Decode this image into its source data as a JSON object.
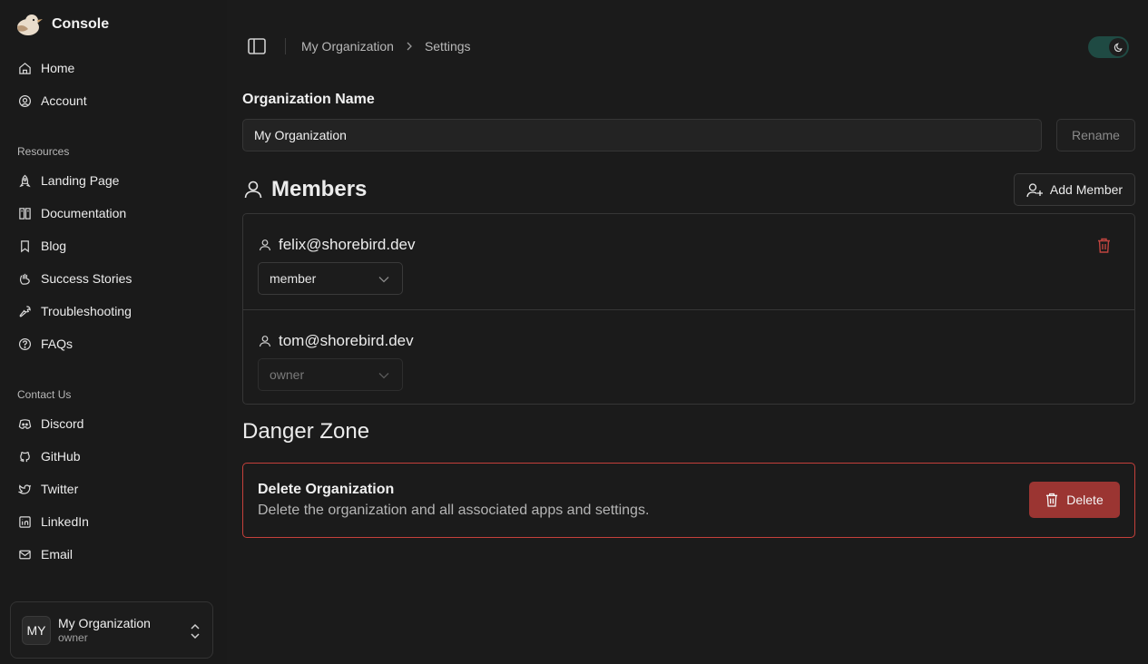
{
  "sidebar": {
    "brand": "Console",
    "primary": [
      {
        "label": "Home",
        "icon": "home-icon"
      },
      {
        "label": "Account",
        "icon": "account-icon"
      }
    ],
    "resources_label": "Resources",
    "resources": [
      {
        "label": "Landing Page",
        "icon": "rocket-icon"
      },
      {
        "label": "Documentation",
        "icon": "docs-icon"
      },
      {
        "label": "Blog",
        "icon": "bookmark-icon"
      },
      {
        "label": "Success Stories",
        "icon": "hand-clap-icon"
      },
      {
        "label": "Troubleshooting",
        "icon": "wrench-icon"
      },
      {
        "label": "FAQs",
        "icon": "help-circle-icon"
      }
    ],
    "contact_label": "Contact Us",
    "contact": [
      {
        "label": "Discord",
        "icon": "discord-icon"
      },
      {
        "label": "GitHub",
        "icon": "github-icon"
      },
      {
        "label": "Twitter",
        "icon": "twitter-icon"
      },
      {
        "label": "LinkedIn",
        "icon": "linkedin-icon"
      },
      {
        "label": "Email",
        "icon": "mail-icon"
      }
    ],
    "org_switcher": {
      "initials": "MY",
      "name": "My Organization",
      "role": "owner"
    }
  },
  "header": {
    "breadcrumb": [
      "My Organization",
      "Settings"
    ],
    "theme": "dark"
  },
  "org_name": {
    "label": "Organization Name",
    "value": "My Organization",
    "rename_label": "Rename"
  },
  "members": {
    "title": "Members",
    "add_label": "Add Member",
    "list": [
      {
        "email": "felix@shorebird.dev",
        "role": "member",
        "editable": true
      },
      {
        "email": "tom@shorebird.dev",
        "role": "owner",
        "editable": false
      }
    ]
  },
  "danger": {
    "title": "Danger Zone",
    "card_title": "Delete Organization",
    "card_desc": "Delete the organization and all associated apps and settings.",
    "delete_label": "Delete"
  },
  "colors": {
    "background": "#1a1a1a",
    "danger": "#9b3532",
    "danger_border": "#c5403b",
    "toggle_on": "#1f4a43"
  }
}
